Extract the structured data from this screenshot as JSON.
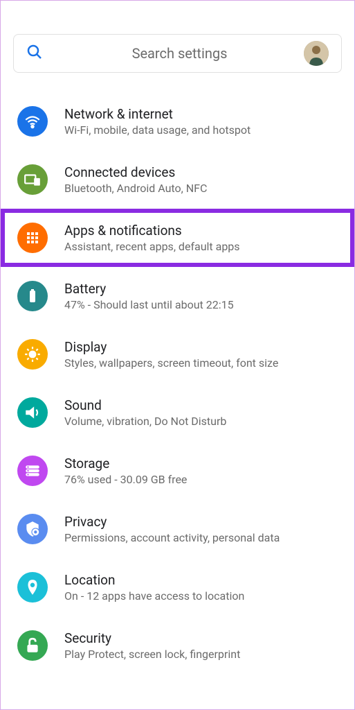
{
  "search": {
    "placeholder": "Search settings"
  },
  "items": [
    {
      "title": "Network & internet",
      "subtitle": "Wi-Fi, mobile, data usage, and hotspot"
    },
    {
      "title": "Connected devices",
      "subtitle": "Bluetooth, Android Auto, NFC"
    },
    {
      "title": "Apps & notifications",
      "subtitle": "Assistant, recent apps, default apps"
    },
    {
      "title": "Battery",
      "subtitle": "47% - Should last until about 22:15"
    },
    {
      "title": "Display",
      "subtitle": "Styles, wallpapers, screen timeout, font size"
    },
    {
      "title": "Sound",
      "subtitle": "Volume, vibration, Do Not Disturb"
    },
    {
      "title": "Storage",
      "subtitle": "76% used - 30.09 GB free"
    },
    {
      "title": "Privacy",
      "subtitle": "Permissions, account activity, personal data"
    },
    {
      "title": "Location",
      "subtitle": "On - 12 apps have access to location"
    },
    {
      "title": "Security",
      "subtitle": "Play Protect, screen lock, fingerprint"
    }
  ]
}
